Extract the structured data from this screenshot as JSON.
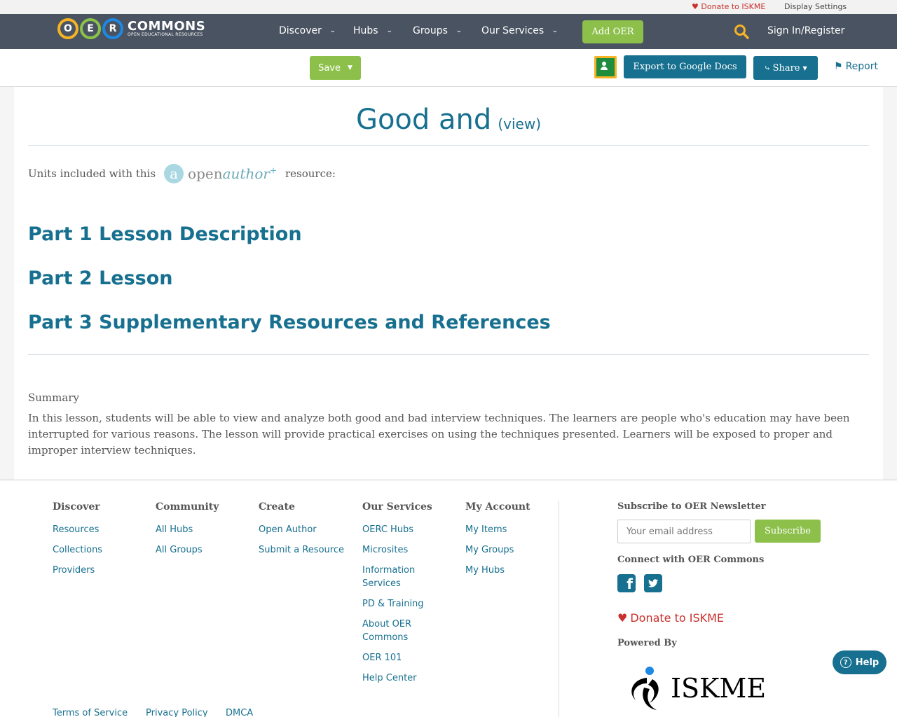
{
  "util": {
    "donate_label": "Donate to ISKME",
    "display_settings": "Display Settings"
  },
  "brand": {
    "logo_letters": [
      "O",
      "E",
      "R"
    ],
    "logo_word": "COMMONS",
    "logo_tagline": "OPEN EDUCATIONAL RESOURCES"
  },
  "nav": {
    "items": [
      {
        "label": "Discover"
      },
      {
        "label": "Hubs"
      },
      {
        "label": "Groups"
      },
      {
        "label": "Our Services"
      }
    ],
    "add_oer": "Add OER",
    "signin": "Sign In/Register"
  },
  "toolbar": {
    "save": "Save",
    "export": "Export to Google Docs",
    "share": "Share",
    "report": "Report"
  },
  "page": {
    "title": "Good and",
    "view_link": "(view)",
    "units_prefix": "Units included with this",
    "units_suffix": "resource:",
    "openauthor_open": "open",
    "openauthor_author": "author",
    "parts": [
      "Part 1 Lesson Description",
      "Part 2 Lesson",
      "Part 3 Supplementary Resources and References"
    ],
    "summary_label": "Summary",
    "summary_text": "In this lesson, students will be able to view and analyze both good and bad interview techniques. The learners are people who's education may have been interrupted for various reasons. The lesson will provide practical exercises on using the techniques presented. Learners will be exposed to proper and improper interview techniques."
  },
  "footer": {
    "columns": [
      {
        "heading": "Discover",
        "links": [
          "Resources",
          "Collections",
          "Providers"
        ]
      },
      {
        "heading": "Community",
        "links": [
          "All Hubs",
          "All Groups"
        ]
      },
      {
        "heading": "Create",
        "links": [
          "Open Author",
          "Submit a Resource"
        ]
      },
      {
        "heading": "Our Services",
        "links": [
          "OERC Hubs",
          "Microsites",
          "Information Services",
          "PD & Training",
          "About OER Commons",
          "OER 101",
          "Help Center"
        ]
      },
      {
        "heading": "My Account",
        "links": [
          "My Items",
          "My Groups",
          "My Hubs"
        ]
      }
    ],
    "newsletter_heading": "Subscribe to OER Newsletter",
    "email_placeholder": "Your email address",
    "subscribe": "Subscribe",
    "connect_heading": "Connect with OER Commons",
    "donate": "Donate to ISKME",
    "powered_by": "Powered By",
    "iskme": "ISKME",
    "legal": [
      "Terms of Service",
      "Privacy Policy",
      "DMCA"
    ]
  },
  "help": "Help",
  "colors": {
    "nav_bg": "#4a5361",
    "accent_green": "#8cc04b",
    "accent_blue": "#17708f",
    "donate_red": "#c9302c",
    "search_yellow": "#f5b325"
  }
}
